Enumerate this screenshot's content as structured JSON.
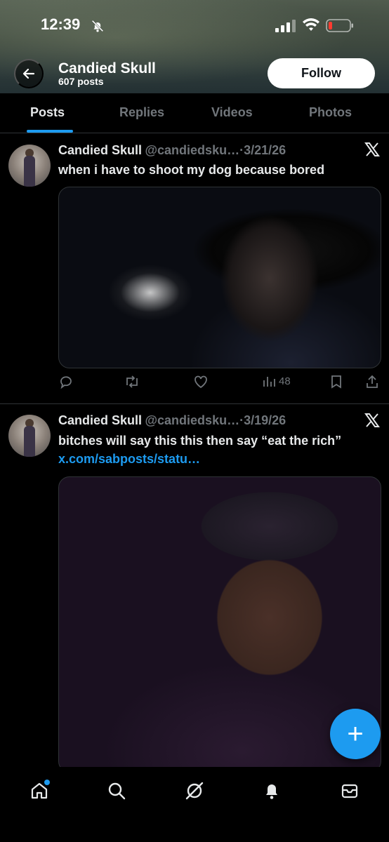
{
  "status_bar": {
    "time": "12:39"
  },
  "header": {
    "profile_name": "Candied Skull",
    "post_count": "607 posts",
    "follow_label": "Follow"
  },
  "tabs": [
    {
      "label": "Posts"
    },
    {
      "label": "Replies"
    },
    {
      "label": "Videos"
    },
    {
      "label": "Photos"
    }
  ],
  "posts": [
    {
      "author": "Candied Skull",
      "handle": "@candiedsku…",
      "date": "·3/21/26",
      "text": "when i have to shoot my dog because  bored",
      "views": "48"
    },
    {
      "author": "Candied Skull",
      "handle": "@candiedsku…",
      "date": "·3/19/26",
      "text": "bitches will say this this then say “eat the rich”",
      "link": "x.com/sabposts/statu…"
    }
  ],
  "fab": {
    "label": "+"
  },
  "colors": {
    "accent": "#1d9bf0",
    "background": "#000000",
    "muted": "#71767b"
  }
}
